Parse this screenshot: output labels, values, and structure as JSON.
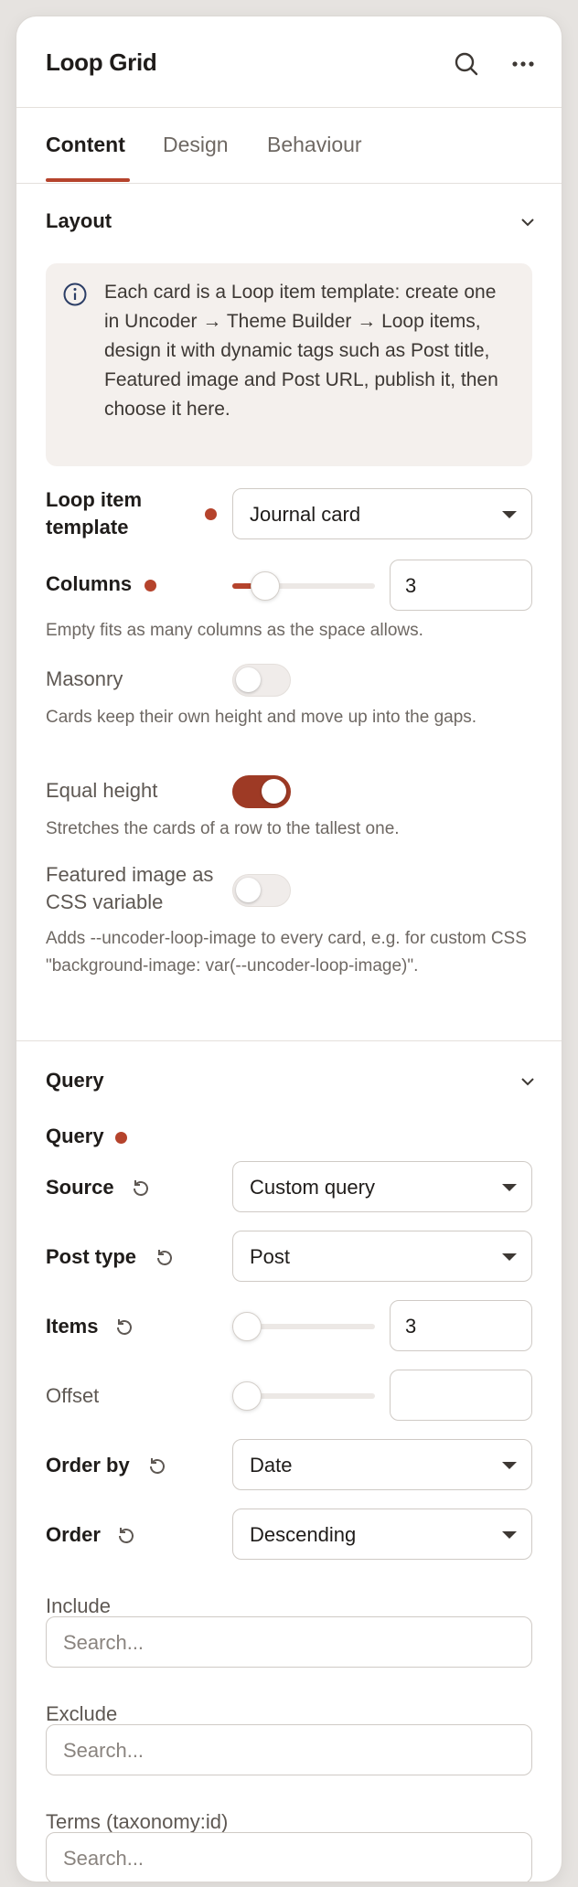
{
  "header": {
    "title": "Loop Grid"
  },
  "tabs": [
    {
      "label": "Content"
    },
    {
      "label": "Design"
    },
    {
      "label": "Behaviour"
    }
  ],
  "layout": {
    "title": "Layout",
    "info": "Each card is a Loop item template: create one in Uncoder → Theme Builder → Loop items, design it with dynamic tags such as Post title, Featured image and Post URL, publish it, then choose it here.",
    "template_label": "Loop item template",
    "template_value": "Journal card",
    "columns_label": "Columns",
    "columns_value": "3",
    "columns_help": "Empty fits as many columns as the space allows.",
    "masonry_label": "Masonry",
    "masonry_on": false,
    "masonry_help": "Cards keep their own height and move up into the gaps.",
    "equal_label": "Equal height",
    "equal_on": true,
    "equal_help": "Stretches the cards of a row to the tallest one.",
    "featured_label": "Featured image as CSS variable",
    "featured_on": false,
    "featured_help": "Adds --uncoder-loop-image to every card, e.g. for custom CSS \"background-image: var(--uncoder-loop-image)\"."
  },
  "query": {
    "title": "Query",
    "sub_label": "Query",
    "source_label": "Source",
    "source_value": "Custom query",
    "post_type_label": "Post type",
    "post_type_value": "Post",
    "items_label": "Items",
    "items_value": "3",
    "offset_label": "Offset",
    "offset_value": "",
    "order_by_label": "Order by",
    "order_by_value": "Date",
    "order_label": "Order",
    "order_value": "Descending",
    "include_label": "Include",
    "include_placeholder": "Search...",
    "exclude_label": "Exclude",
    "exclude_placeholder": "Search...",
    "terms_label": "Terms (taxonomy:id)",
    "terms_placeholder": "Search..."
  },
  "colors": {
    "accent": "#b5432c",
    "toggle_on": "#9e3a25"
  }
}
